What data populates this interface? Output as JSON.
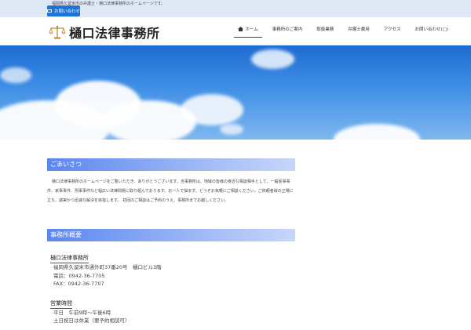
{
  "topbar": {
    "tagline": "福岡県久留米市の弁護士・樋口法律事務所のホームページです。",
    "contact_label": "お問い合わせ"
  },
  "header": {
    "logo_text": "樋口法律事務所"
  },
  "nav": [
    {
      "label": "ホーム",
      "icon": "home-icon",
      "active": true
    },
    {
      "label": "事務所のご案内"
    },
    {
      "label": "取扱業務"
    },
    {
      "label": "弁護士費用"
    },
    {
      "label": "アクセス"
    },
    {
      "label": "お問い合わせ(□)"
    }
  ],
  "intro": {
    "heading": "ごあいさつ",
    "body": "樋口法律事務所のホームページをご覧いただき、ありがとうございます。当事務所は、地域の皆様の身近な相談相手として、一般民事事件、家事事件、刑事事件など幅広い法律問題に取り組んでおります。お一人で悩まず、どうぞお気軽にご相談ください。ご依頼者様の立場に立ち、誠実かつ迅速な解決を目指します。  初回のご相談はご予約のうえ、事務所までお越しください。"
  },
  "office": {
    "heading": "事務所概要",
    "blocks": [
      {
        "title": "樋口法律事務所",
        "lines": [
          "福岡県久留米市通外町37番20号　樋口ビル3階",
          "電話：0942-36-7705",
          "FAX：0942-36-7707"
        ]
      },
      {
        "title": "営業時間",
        "lines": [
          "平日　午前9時〜午後6時",
          "土日祝日は休業（要予約相談可）"
        ]
      }
    ]
  },
  "colors": {
    "accent": "#1e73d6",
    "heading_start": "#5b86ef",
    "heading_end": "#c7d6fb",
    "topbar": "#dfe9f6"
  }
}
